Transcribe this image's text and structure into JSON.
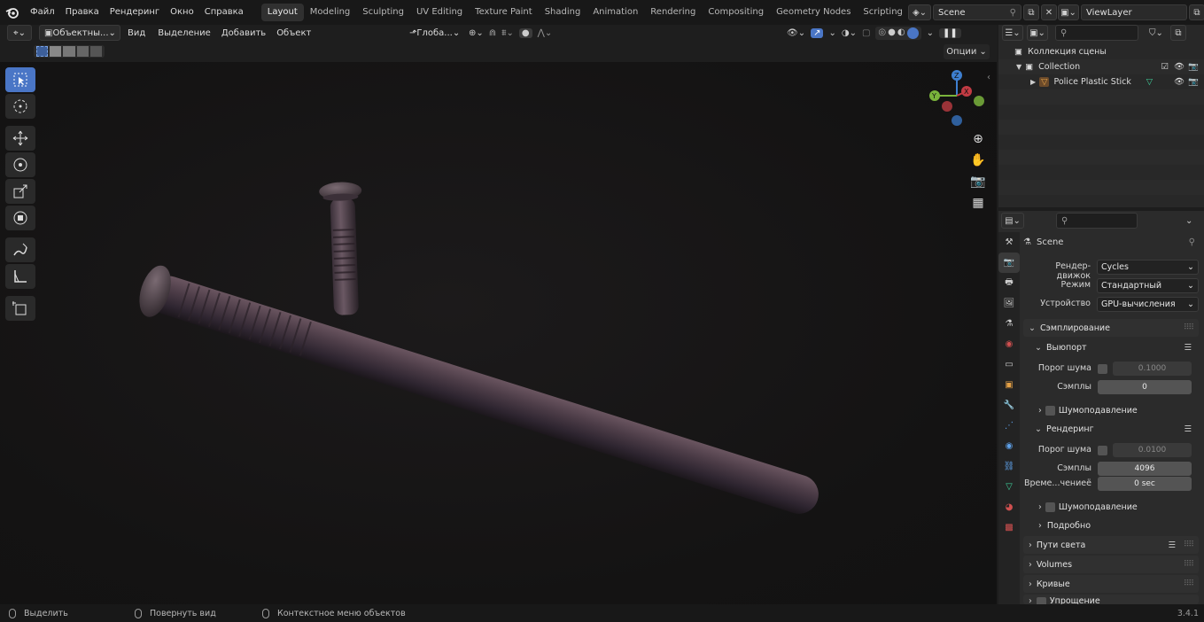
{
  "menubar": {
    "items": [
      "Файл",
      "Правка",
      "Рендеринг",
      "Окно",
      "Справка"
    ],
    "workspaces": [
      "Layout",
      "Modeling",
      "Sculpting",
      "UV Editing",
      "Texture Paint",
      "Shading",
      "Animation",
      "Rendering",
      "Compositing",
      "Geometry Nodes",
      "Scripting"
    ],
    "active_workspace": "Layout",
    "scene_name": "Scene",
    "view_layer": "ViewLayer"
  },
  "viewport_header": {
    "mode": "Объектны...",
    "menus": [
      "Вид",
      "Выделение",
      "Добавить",
      "Объект"
    ],
    "transform_orientation": "Глоба...",
    "options_label": "Опции"
  },
  "toolbar": {
    "tools": [
      "select-box",
      "cursor",
      "move",
      "rotate",
      "scale",
      "transform",
      "annotate",
      "measure",
      "add-cube"
    ],
    "active": "select-box"
  },
  "object": {
    "name": "Police Plastic Stick",
    "color": "#4a3c47"
  },
  "outliner": {
    "scene_collection": "Коллекция сцены",
    "collection": "Collection",
    "object": "Police Plastic Stick"
  },
  "properties": {
    "context": "Scene",
    "render_engine_label": "Рендер-движок",
    "render_engine": "Cycles",
    "mode_label": "Режим",
    "mode": "Стандартный",
    "device_label": "Устройство",
    "device": "GPU-вычисления",
    "sampling": {
      "title": "Сэмплирование",
      "viewport": {
        "title": "Выюпорт",
        "noise_threshold_label": "Порог шума",
        "noise_threshold": "0.1000",
        "samples_label": "Сэмплы",
        "samples": "0",
        "denoise_label": "Шумоподавление"
      },
      "render": {
        "title": "Рендеринг",
        "noise_threshold_label": "Порог шума",
        "noise_threshold": "0.0100",
        "samples_label": "Сэмплы",
        "samples": "4096",
        "time_limit_label": "Време...чениеё",
        "time_limit": "0 sec",
        "denoise_label": "Шумоподавление",
        "advanced_label": "Подробно"
      }
    },
    "panels": [
      "Пути света",
      "Volumes",
      "Кривые",
      "Упрощение"
    ]
  },
  "statusbar": {
    "select": "Выделить",
    "rotate_view": "Повернуть вид",
    "context_menu": "Контекстное меню объектов",
    "version": "3.4.1"
  },
  "colors": {
    "accent": "#4a76c6",
    "gizmo_x": "#c23b43",
    "gizmo_y": "#7ab33b",
    "gizmo_z": "#3e7fd0"
  }
}
